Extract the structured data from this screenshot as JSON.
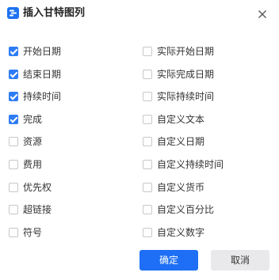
{
  "dialog": {
    "title": "插入甘特图列",
    "title_icon": "app-logo-icon",
    "close_icon": "close-icon"
  },
  "left_column": [
    {
      "label": "开始日期",
      "checked": true
    },
    {
      "label": "结束日期",
      "checked": true
    },
    {
      "label": "持续时间",
      "checked": true
    },
    {
      "label": "完成",
      "checked": true
    },
    {
      "label": "资源",
      "checked": false
    },
    {
      "label": "费用",
      "checked": false
    },
    {
      "label": "优先权",
      "checked": false
    },
    {
      "label": "超链接",
      "checked": false
    },
    {
      "label": "符号",
      "checked": false
    }
  ],
  "right_column": [
    {
      "label": "实际开始日期",
      "checked": false
    },
    {
      "label": "实际完成日期",
      "checked": false
    },
    {
      "label": "实际持续时间",
      "checked": false
    },
    {
      "label": "自定义文本",
      "checked": false
    },
    {
      "label": "自定义日期",
      "checked": false
    },
    {
      "label": "自定义持续时间",
      "checked": false
    },
    {
      "label": "自定义货币",
      "checked": false
    },
    {
      "label": "自定义百分比",
      "checked": false
    },
    {
      "label": "自定义数字",
      "checked": false
    }
  ],
  "buttons": {
    "ok_label": "确定",
    "cancel_label": "取消"
  },
  "colors": {
    "accent": "#2f7cf6",
    "primary_button": "#1e6ff5",
    "secondary_button": "#e9e9eb"
  }
}
